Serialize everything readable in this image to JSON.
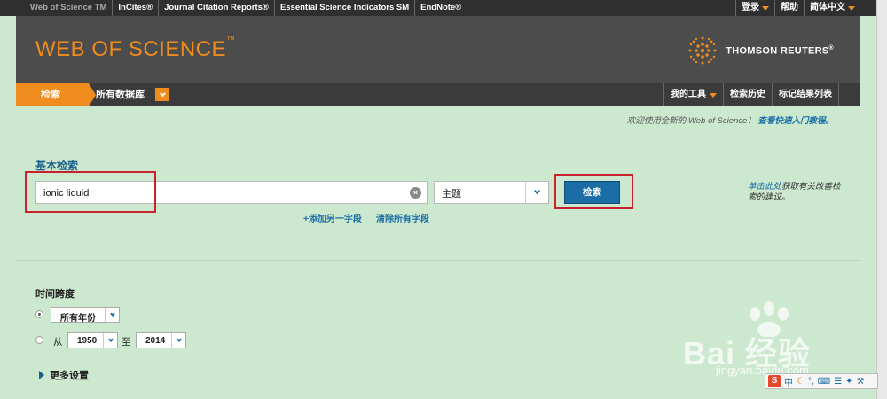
{
  "top_links": [
    "Web of Science TM",
    "InCites®",
    "Journal Citation Reports®",
    "Essential Science Indicators SM",
    "EndNote®"
  ],
  "top_right": {
    "login": "登录",
    "help": "帮助",
    "language": "简体中文"
  },
  "header": {
    "brand": "WEB OF SCIENCE",
    "brand_tm": "™",
    "publisher": "THOMSON REUTERS",
    "publisher_tm": "®"
  },
  "nav": {
    "search_tab": "检索",
    "database": "所有数据库",
    "my_tools": "我的工具",
    "history": "检索历史",
    "marked_list": "标记结果列表"
  },
  "welcome": {
    "text": "欢迎使用全新的 Web of Science！",
    "link": "查看快速入门教程。"
  },
  "basic_search": {
    "title": "基本检索",
    "query_value": "ionic liquid",
    "field": "主题",
    "search_button": "检索",
    "add_field": "+添加另一字段",
    "clear_all": "清除所有字段",
    "tip_link": "单击此处",
    "tip_text": "获取有关改善检索的建议。"
  },
  "timespan": {
    "title": "时间跨度",
    "all_years": "所有年份",
    "from_label": "从",
    "to_label": "至",
    "from_year": "1950",
    "to_year": "2014"
  },
  "more_settings": "更多设置",
  "watermark": {
    "brand": "Bai 经验",
    "url": "jingyan.baidu.com"
  },
  "ime": {
    "logo": "S",
    "mode": "中"
  },
  "colors": {
    "accent": "#f08c1e",
    "link": "#1b6ea5",
    "highlight": "#c8232c",
    "background": "#cce8cf"
  }
}
